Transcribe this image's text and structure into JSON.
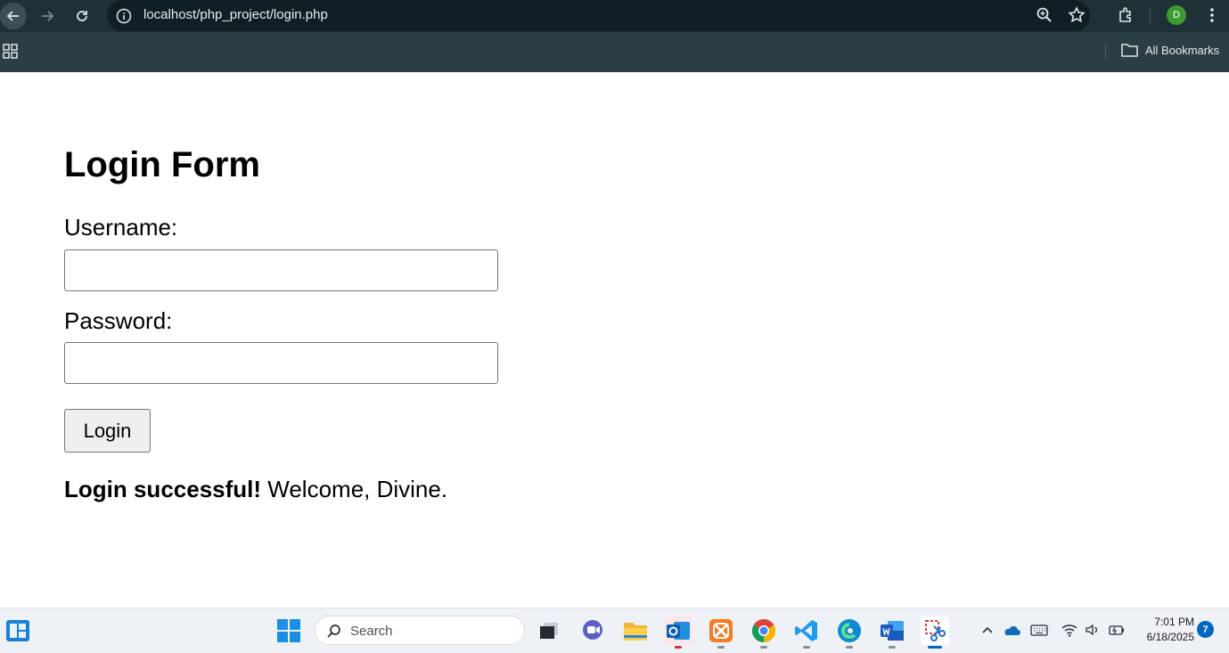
{
  "browser": {
    "url": "localhost/php_project/login.php",
    "profile_initial": "D",
    "bookmarks_label": "All Bookmarks"
  },
  "form": {
    "title": "Login Form",
    "username_label": "Username:",
    "username_value": "",
    "password_label": "Password:",
    "password_value": "",
    "submit_label": "Login"
  },
  "message": {
    "strong": "Login successful!",
    "rest": " Welcome, Divine."
  },
  "taskbar": {
    "search_placeholder": "Search",
    "time": "7:01 PM",
    "date": "6/18/2025",
    "notification_count": "7"
  },
  "colors": {
    "chrome_top": "#1f3037",
    "chrome_bookmarks": "#2b3e45",
    "taskbar_bg": "#eef1f6",
    "accent_blue": "#0067c0"
  }
}
